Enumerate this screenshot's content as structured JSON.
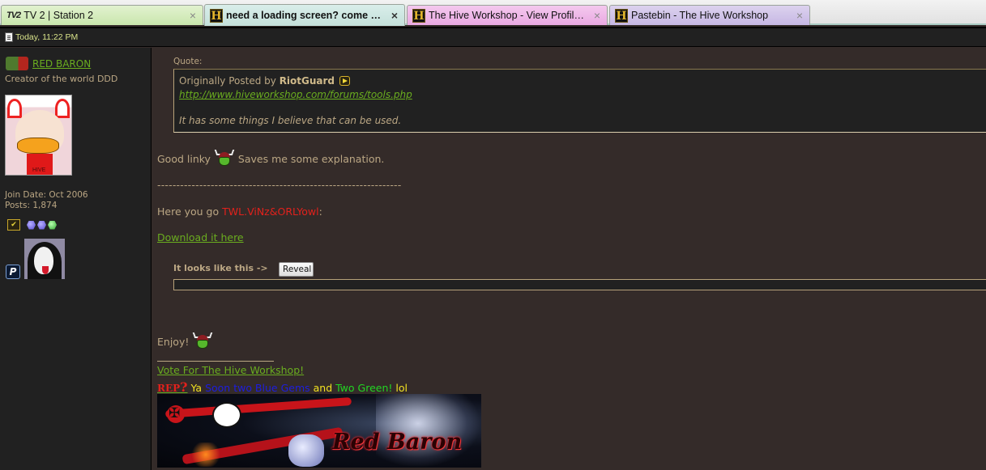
{
  "browser": {
    "tabs": [
      {
        "title": "TV 2 | Station 2",
        "favicon": "tv2-icon",
        "active": false,
        "color": "#c9e6ad"
      },
      {
        "title": "need a loading screen? come her...",
        "favicon": "hive-icon",
        "active": true,
        "color": "#c4e0da"
      },
      {
        "title": "The Hive Workshop - View Profile: ...",
        "favicon": "hive-icon",
        "active": false,
        "color": "#e9a9e2"
      },
      {
        "title": "Pastebin - The Hive Workshop",
        "favicon": "hive-icon",
        "active": false,
        "color": "#c6b7e4"
      }
    ],
    "close_glyph": "×",
    "tv2_glyph": "TV2",
    "hive_glyph": "H"
  },
  "post": {
    "date": "Today, 11:22 PM",
    "author": {
      "name": "RED BARON",
      "title": "Creator of the world DDD",
      "avatar_text": "HIVE",
      "join_date": "Join Date: Oct 2006",
      "posts": "Posts: 1,874",
      "badge_check_glyph": "✔",
      "gems": [
        "blue",
        "blue",
        "green"
      ],
      "premium_glyph": "P"
    },
    "quote": {
      "label": "Quote:",
      "prefix": "Originally Posted by",
      "author": "RiotGuard",
      "link": "http://www.hiveworkshop.com/forums/tools.php",
      "text": "It has some things I believe that can be used."
    },
    "body": {
      "line1_before": "Good linky",
      "line1_after": "Saves me some explanation.",
      "separator": "----------------------------------------------------------------",
      "line2_before": "Here you go",
      "line2_name": "TWL.ViNz&ORLYowl",
      "line2_after": ":",
      "download_link": "Download it here",
      "spoiler_label": "It looks like this ->",
      "reveal_button": "Reveal",
      "enjoy": "Enjoy!"
    },
    "signature": {
      "vote_link": "Vote For The Hive Workshop!",
      "rep_word": "REP",
      "rep_q": "?",
      "rep_parts": [
        {
          "text": " Ya ",
          "color": "#f3e321"
        },
        {
          "text": "Soon two Blue Gems",
          "color": "#1d1de0"
        },
        {
          "text": " and ",
          "color": "#f3e321"
        },
        {
          "text": "Two Green!",
          "color": "#22d622"
        },
        {
          "text": " lol",
          "color": "#f3e321"
        }
      ],
      "banner_title": "Red Baron",
      "banner_cross": "✠"
    }
  },
  "colors": {
    "link_green": "#6aad1f",
    "text_tan": "#bba784",
    "name_red": "#e2211c",
    "sidebar_bg": "#212121",
    "content_bg": "#342b29",
    "date_yellow": "#d8e28a"
  }
}
